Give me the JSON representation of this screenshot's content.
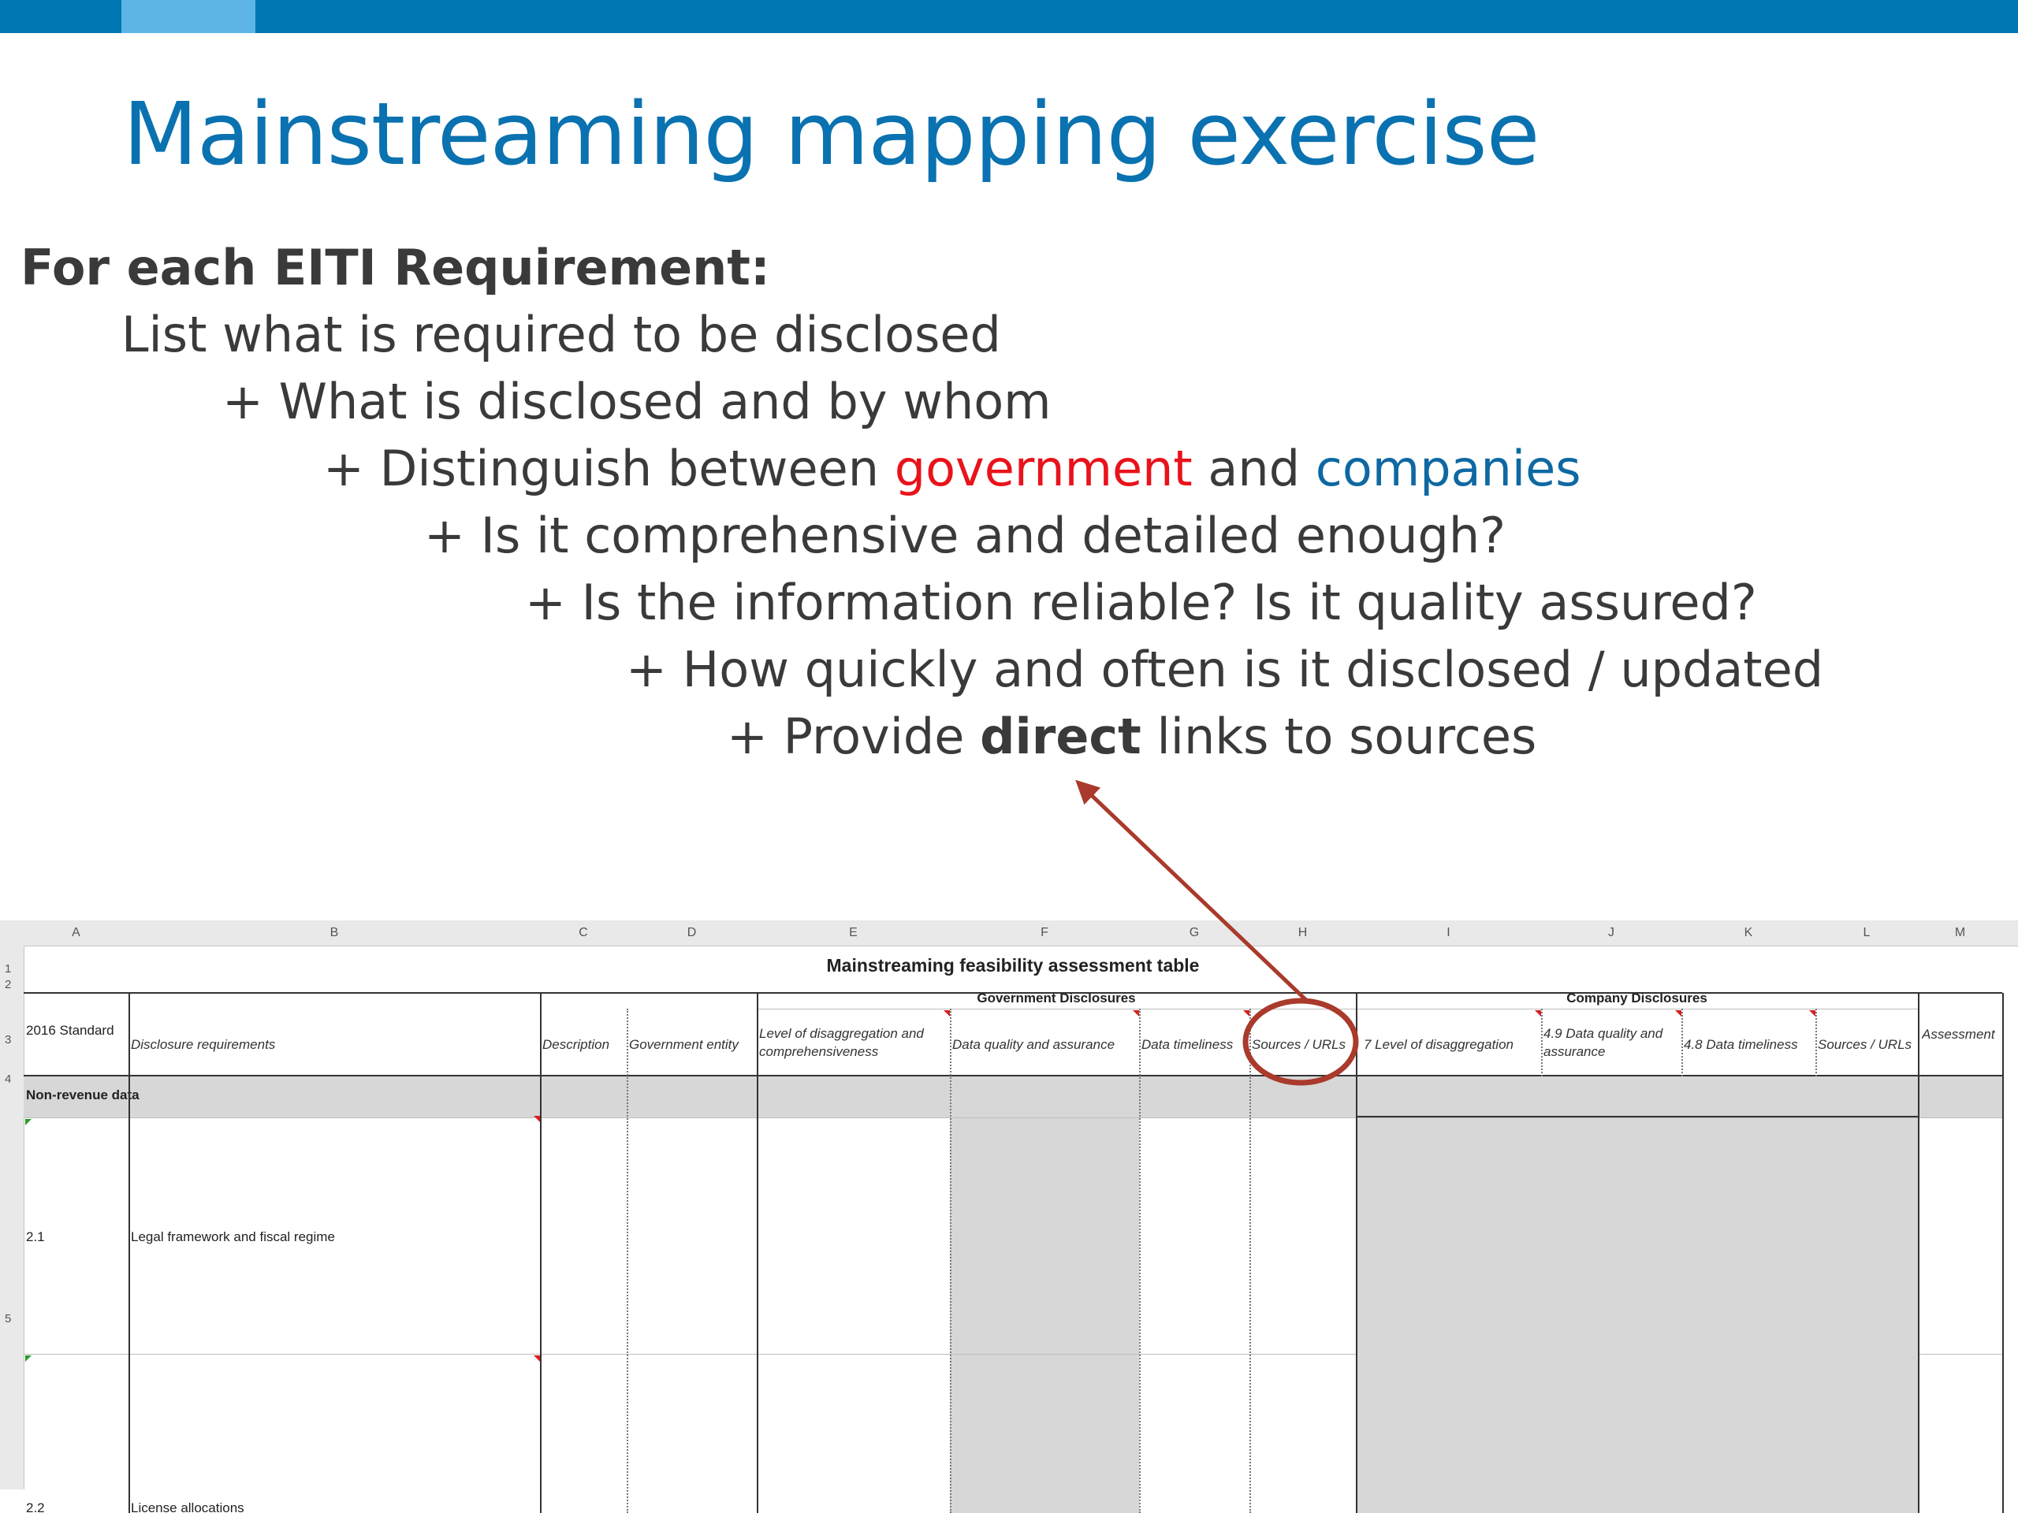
{
  "slide": {
    "title": "Mainstreaming mapping exercise",
    "heading": "For each EITI Requirement:",
    "line1": "List what is required to be disclosed",
    "line2": "+ What is disclosed and by whom",
    "line3_prefix": "+ Distinguish between ",
    "line3_red": "government",
    "line3_mid": " and ",
    "line3_blue": "companies",
    "line4": "+ Is it comprehensive and detailed enough?",
    "line5": "+ Is the information reliable? Is it quality assured?",
    "line6": "+ How quickly and often is it disclosed / updated",
    "line7_prefix": "+ Provide ",
    "line7_bold": "direct",
    "line7_suffix": " links to sources",
    "colors": {
      "bar": "#0077b0",
      "bar_accent": "#5cb5e4",
      "title": "#0a72b0",
      "red": "#e8131b",
      "blue": "#0e68a2",
      "annotation": "#a93a2c"
    }
  },
  "sheet": {
    "columns": [
      "A",
      "B",
      "C",
      "D",
      "E",
      "F",
      "G",
      "H",
      "I",
      "J",
      "K",
      "L",
      "M"
    ],
    "rows": [
      "1",
      "2",
      "3",
      "4",
      "5"
    ],
    "table_title": "Mainstreaming feasibility assessment table",
    "gov_group": "Government Disclosures",
    "company_group": "Company Disclosures",
    "headers": {
      "standard": "2016 Standard",
      "requirements": "Disclosure requirements",
      "description": "Description",
      "entity": "Government entity",
      "disagg": "Level of disaggregation and comprehensiveness",
      "quality": "Data quality and assurance",
      "timeliness": "Data timeliness",
      "sources": "Sources / URLs",
      "c_disagg": "7 Level of disaggregation",
      "c_quality": "4.9 Data quality and assurance",
      "c_timeliness": "4.8 Data timeliness",
      "c_sources": "Sources / URLs",
      "assessment": "Assessment"
    },
    "section": "Non-revenue data",
    "data_rows": [
      {
        "num": "2.1",
        "label": "Legal framework and fiscal regime"
      },
      {
        "num": "2.2",
        "label": "License allocations"
      }
    ]
  }
}
